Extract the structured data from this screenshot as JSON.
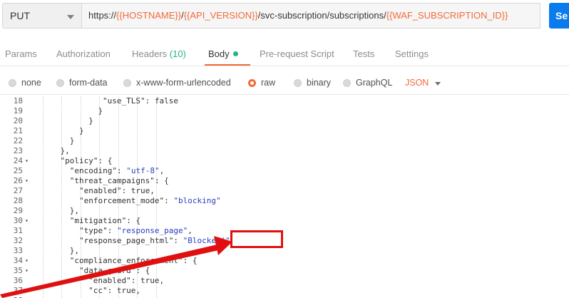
{
  "request": {
    "method": "PUT",
    "url_parts": [
      {
        "text": "https://",
        "var": false
      },
      {
        "text": "{{HOSTNAME}}",
        "var": true
      },
      {
        "text": "/",
        "var": false
      },
      {
        "text": "{{API_VERSION}}",
        "var": true
      },
      {
        "text": "/svc-subscription/subscriptions/",
        "var": false
      },
      {
        "text": "{{WAF_SUBSCRIPTION_ID}}",
        "var": true
      }
    ],
    "send_label": "Se"
  },
  "tabs": [
    {
      "label": "Params",
      "count": "",
      "active": false
    },
    {
      "label": "Authorization",
      "count": "",
      "active": false
    },
    {
      "label": "Headers",
      "count": "(10)",
      "active": false
    },
    {
      "label": "Body",
      "count": "",
      "active": true
    },
    {
      "label": "Pre-request Script",
      "count": "",
      "active": false
    },
    {
      "label": "Tests",
      "count": "",
      "active": false
    },
    {
      "label": "Settings",
      "count": "",
      "active": false
    }
  ],
  "body_types": [
    {
      "label": "none",
      "selected": false
    },
    {
      "label": "form-data",
      "selected": false
    },
    {
      "label": "x-www-form-urlencoded",
      "selected": false
    },
    {
      "label": "raw",
      "selected": true
    },
    {
      "label": "binary",
      "selected": false
    },
    {
      "label": "GraphQL",
      "selected": false
    }
  ],
  "format": "JSON",
  "editor_lines": [
    {
      "n": "18",
      "fold": false,
      "indent": 13,
      "parts": [
        {
          "t": "\"use_TLS\"",
          "c": "key"
        },
        {
          "t": ": false",
          "c": ""
        }
      ]
    },
    {
      "n": "19",
      "fold": false,
      "indent": 12,
      "parts": [
        {
          "t": "}",
          "c": ""
        }
      ]
    },
    {
      "n": "20",
      "fold": false,
      "indent": 10,
      "parts": [
        {
          "t": "}",
          "c": ""
        }
      ]
    },
    {
      "n": "21",
      "fold": false,
      "indent": 8,
      "parts": [
        {
          "t": "}",
          "c": ""
        }
      ]
    },
    {
      "n": "22",
      "fold": false,
      "indent": 6,
      "parts": [
        {
          "t": "}",
          "c": ""
        }
      ]
    },
    {
      "n": "23",
      "fold": false,
      "indent": 4,
      "parts": [
        {
          "t": "},",
          "c": ""
        }
      ]
    },
    {
      "n": "24",
      "fold": true,
      "indent": 4,
      "parts": [
        {
          "t": "\"policy\"",
          "c": "key"
        },
        {
          "t": ": {",
          "c": ""
        }
      ]
    },
    {
      "n": "25",
      "fold": false,
      "indent": 6,
      "parts": [
        {
          "t": "\"encoding\"",
          "c": "key"
        },
        {
          "t": ": ",
          "c": ""
        },
        {
          "t": "\"utf-8\"",
          "c": "str"
        },
        {
          "t": ",",
          "c": ""
        }
      ]
    },
    {
      "n": "26",
      "fold": true,
      "indent": 6,
      "parts": [
        {
          "t": "\"threat_campaigns\"",
          "c": "key"
        },
        {
          "t": ": {",
          "c": ""
        }
      ]
    },
    {
      "n": "27",
      "fold": false,
      "indent": 8,
      "parts": [
        {
          "t": "\"enabled\"",
          "c": "key"
        },
        {
          "t": ": true,",
          "c": ""
        }
      ]
    },
    {
      "n": "28",
      "fold": false,
      "indent": 8,
      "parts": [
        {
          "t": "\"enforcement_mode\"",
          "c": "key"
        },
        {
          "t": ": ",
          "c": ""
        },
        {
          "t": "\"blocking\"",
          "c": "str"
        }
      ]
    },
    {
      "n": "29",
      "fold": false,
      "indent": 6,
      "parts": [
        {
          "t": "},",
          "c": ""
        }
      ]
    },
    {
      "n": "30",
      "fold": true,
      "indent": 6,
      "parts": [
        {
          "t": "\"mitigation\"",
          "c": "key"
        },
        {
          "t": ": {",
          "c": ""
        }
      ]
    },
    {
      "n": "31",
      "fold": false,
      "indent": 8,
      "parts": [
        {
          "t": "\"type\"",
          "c": "key"
        },
        {
          "t": ": ",
          "c": ""
        },
        {
          "t": "\"response_page\"",
          "c": "str"
        },
        {
          "t": ",",
          "c": ""
        }
      ]
    },
    {
      "n": "32",
      "fold": false,
      "indent": 8,
      "parts": [
        {
          "t": "\"response_page_html\"",
          "c": "key"
        },
        {
          "t": ": ",
          "c": ""
        },
        {
          "t": "\"Blocked!\"",
          "c": "str"
        }
      ]
    },
    {
      "n": "33",
      "fold": false,
      "indent": 6,
      "parts": [
        {
          "t": "},",
          "c": ""
        }
      ]
    },
    {
      "n": "34",
      "fold": true,
      "indent": 6,
      "parts": [
        {
          "t": "\"compliance_enforcement\"",
          "c": "key"
        },
        {
          "t": ": {",
          "c": ""
        }
      ]
    },
    {
      "n": "35",
      "fold": true,
      "indent": 8,
      "parts": [
        {
          "t": "\"data_guard\"",
          "c": "key"
        },
        {
          "t": ": {",
          "c": ""
        }
      ]
    },
    {
      "n": "36",
      "fold": false,
      "indent": 10,
      "parts": [
        {
          "t": "\"enabled\"",
          "c": "key"
        },
        {
          "t": ": true,",
          "c": ""
        }
      ]
    },
    {
      "n": "37",
      "fold": false,
      "indent": 10,
      "parts": [
        {
          "t": "\"cc\"",
          "c": "key"
        },
        {
          "t": ": true,",
          "c": ""
        }
      ]
    },
    {
      "n": "38",
      "fold": false,
      "indent": 10,
      "parts": [
        {
          "t": "",
          "c": ""
        }
      ]
    }
  ],
  "colors": {
    "accent": "#f26b3a",
    "send": "#097bed",
    "annotation": "#e01010"
  }
}
